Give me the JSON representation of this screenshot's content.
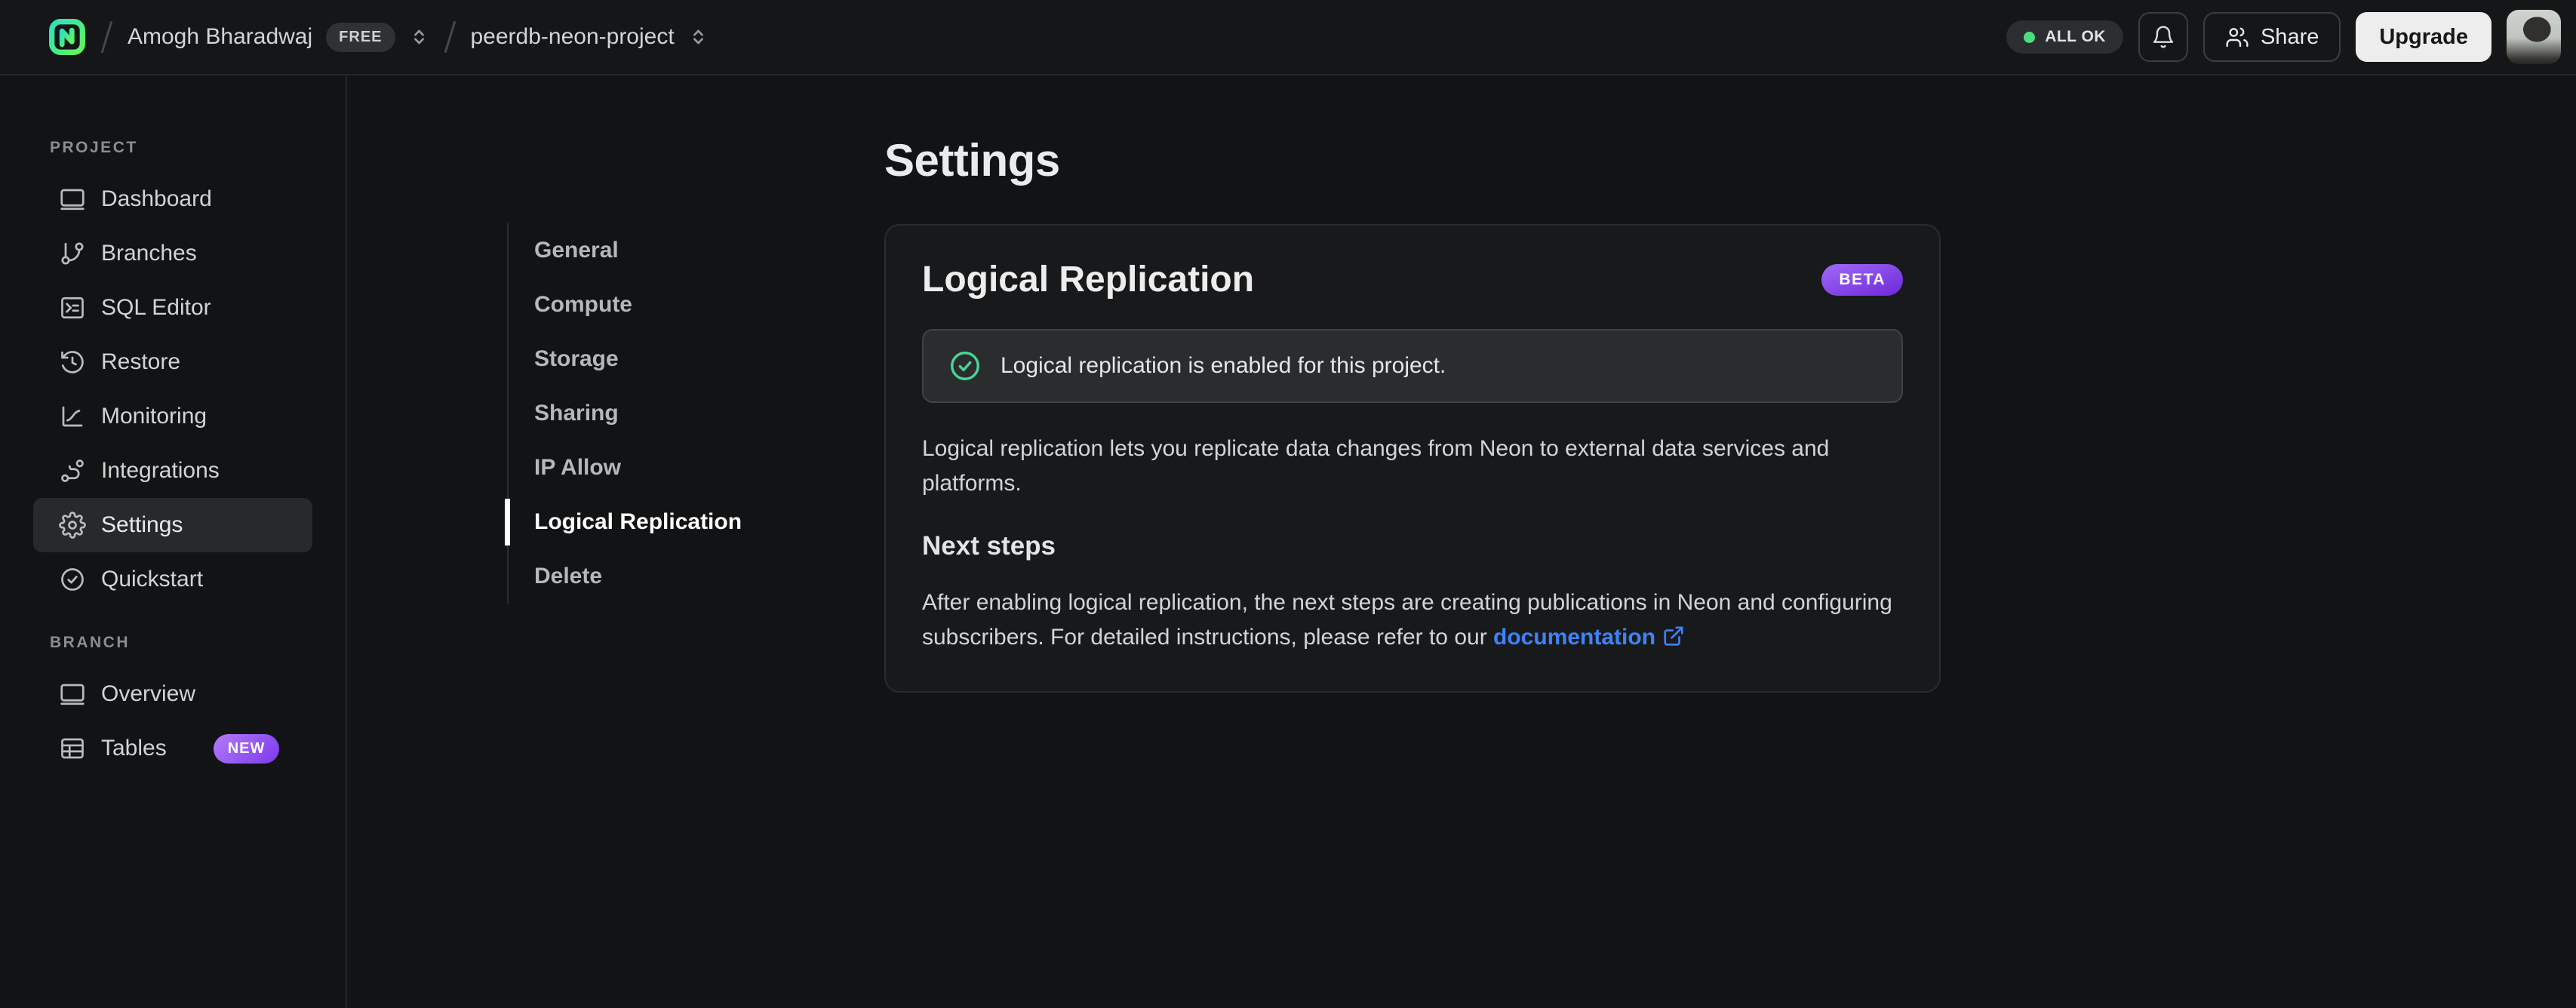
{
  "topbar": {
    "org_name": "Amogh Bharadwaj",
    "org_plan_badge": "FREE",
    "project_name": "peerdb-neon-project",
    "status_label": "ALL OK",
    "share_label": "Share",
    "upgrade_label": "Upgrade"
  },
  "sidebar": {
    "sections": [
      {
        "label": "PROJECT",
        "items": [
          {
            "label": "Dashboard"
          },
          {
            "label": "Branches"
          },
          {
            "label": "SQL Editor"
          },
          {
            "label": "Restore"
          },
          {
            "label": "Monitoring"
          },
          {
            "label": "Integrations"
          },
          {
            "label": "Settings",
            "active": true
          },
          {
            "label": "Quickstart"
          }
        ]
      },
      {
        "label": "BRANCH",
        "items": [
          {
            "label": "Overview"
          },
          {
            "label": "Tables",
            "badge": "NEW"
          }
        ]
      }
    ]
  },
  "settings_nav": {
    "items": [
      {
        "label": "General"
      },
      {
        "label": "Compute"
      },
      {
        "label": "Storage"
      },
      {
        "label": "Sharing"
      },
      {
        "label": "IP Allow"
      },
      {
        "label": "Logical Replication",
        "active": true
      },
      {
        "label": "Delete"
      }
    ]
  },
  "main": {
    "page_title": "Settings",
    "card": {
      "title": "Logical Replication",
      "badge": "BETA",
      "alert_text": "Logical replication is enabled for this project.",
      "description": "Logical replication lets you replicate data changes from Neon to external data services and platforms.",
      "next_steps_title": "Next steps",
      "next_steps_before_link": "After enabling logical replication, the next steps are creating publications in Neon and configuring subscribers. For detailed instructions, please refer to our ",
      "link_label": "documentation"
    }
  },
  "colors": {
    "background": "#121314",
    "card_background": "#18191b",
    "alert_background": "#2a2c2e",
    "accent_green": "#4ade80",
    "brand_gradient_start": "#2de0c0",
    "brand_gradient_end": "#63f655",
    "badge_purple_start": "#a06af8",
    "badge_purple_end": "#6d28d9",
    "link_blue": "#3e83f8"
  }
}
